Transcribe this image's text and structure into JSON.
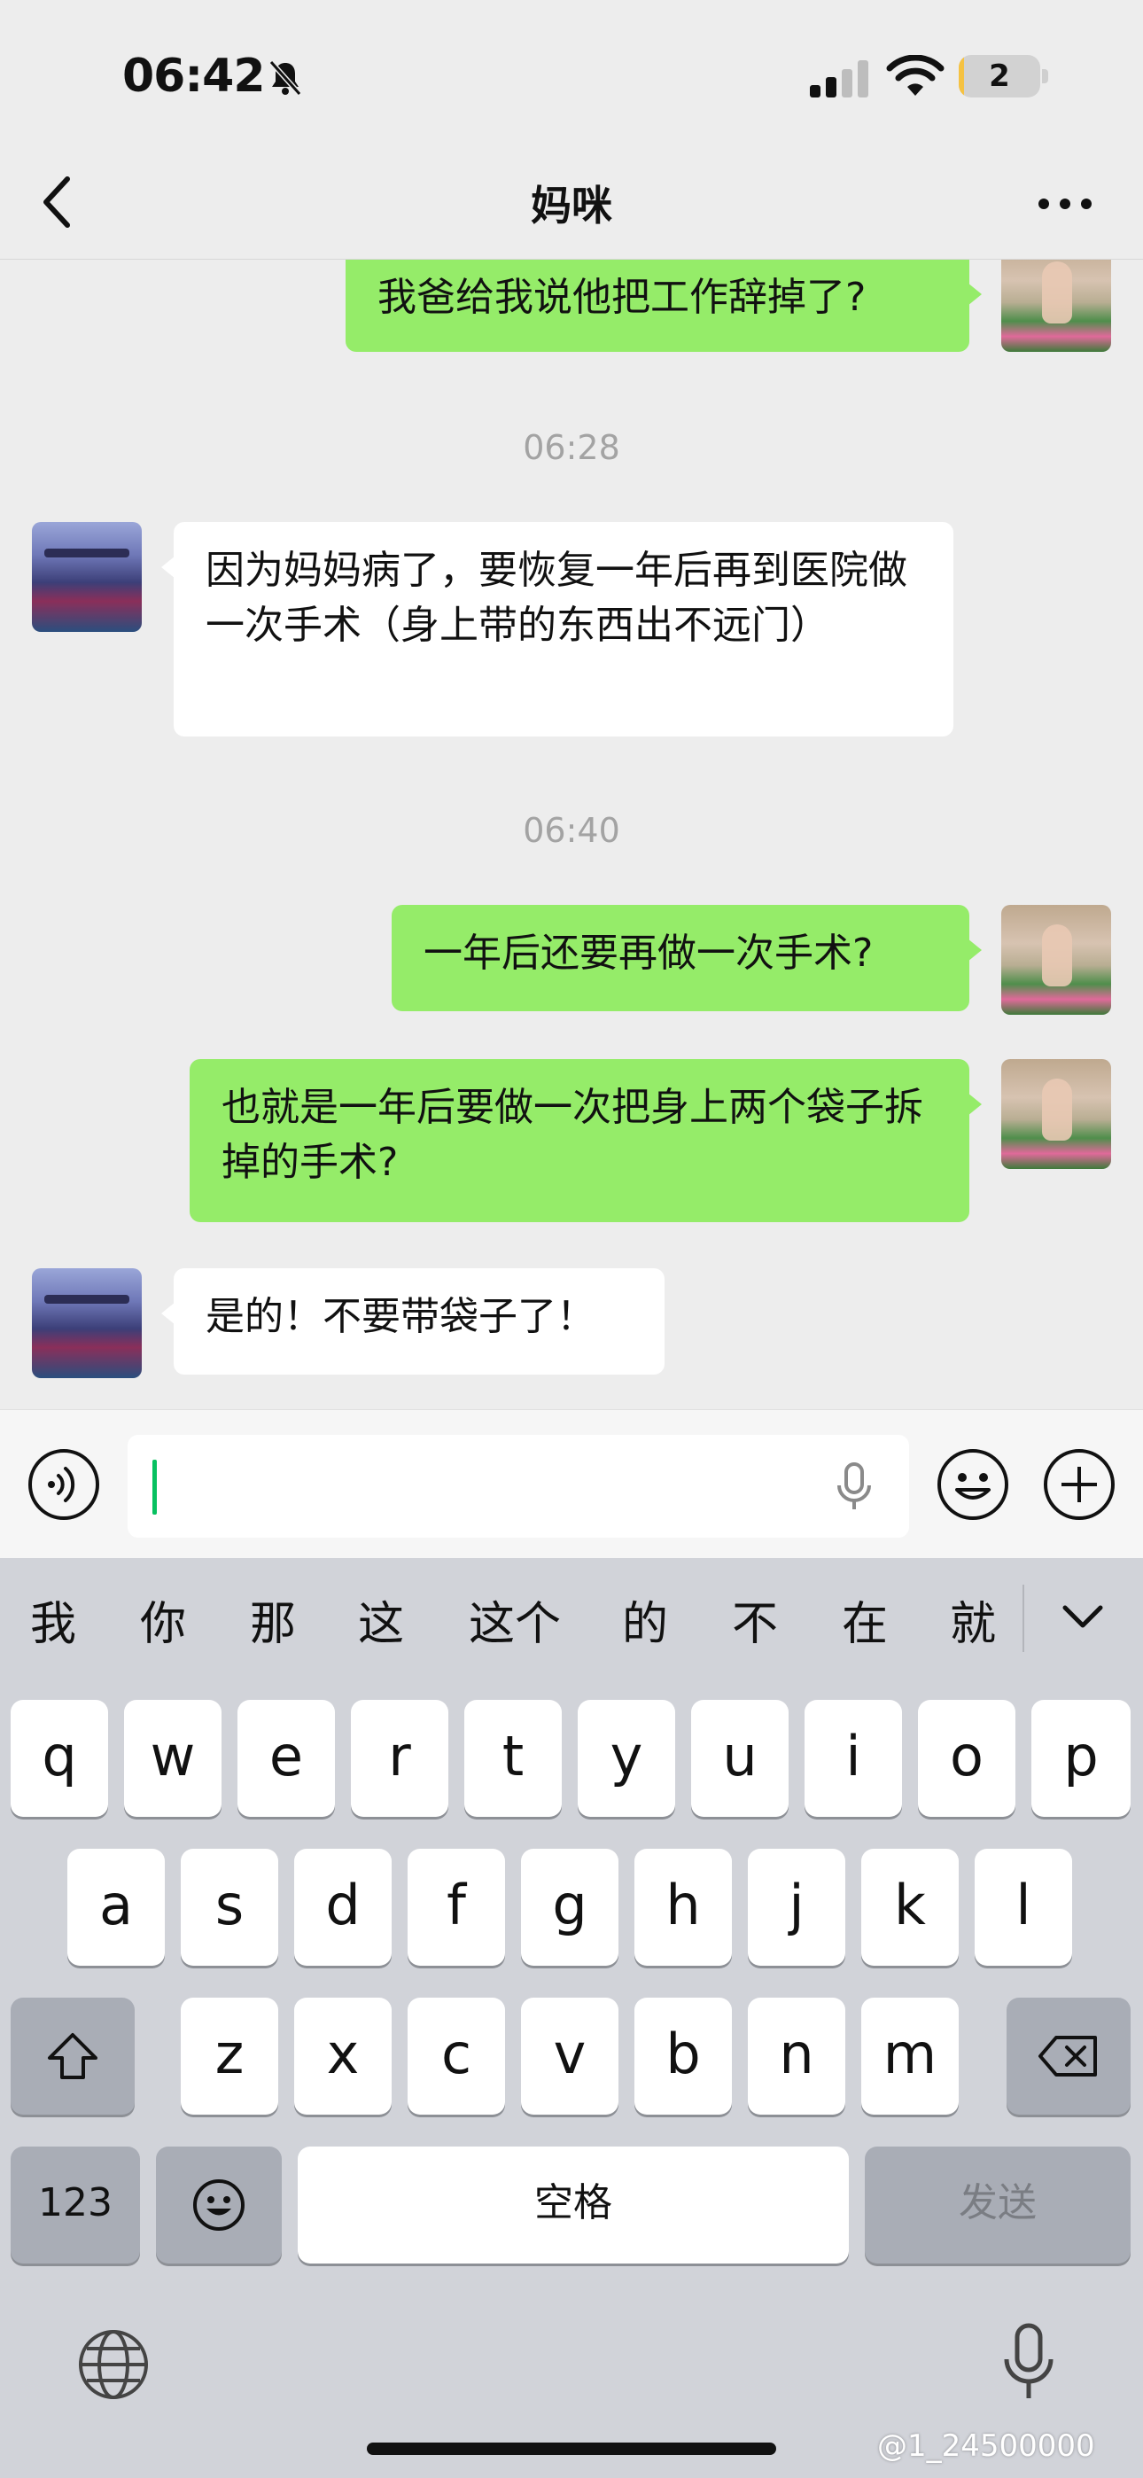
{
  "status_bar": {
    "time": "06:42",
    "battery_level": "2",
    "battery_fraction": 0.02,
    "icons": [
      "bell-off-icon",
      "signal-icon",
      "wifi-icon",
      "battery-icon"
    ]
  },
  "nav": {
    "back_icon": "chevron-left-icon",
    "title": "妈咪",
    "more_icon": "more-icon"
  },
  "chat": {
    "messages": [
      {
        "sender": "self",
        "text": "我爸给我说他把工作辞掉了?"
      },
      {
        "type": "time",
        "text": "06:28"
      },
      {
        "sender": "mom",
        "text": "因为妈妈病了，要恢复一年后再到医院做一次手术（身上带的东西出不远门）"
      },
      {
        "type": "time",
        "text": "06:40"
      },
      {
        "sender": "self",
        "text": "一年后还要再做一次手术?"
      },
      {
        "sender": "self",
        "text": "也就是一年后要做一次把身上两个袋子拆掉的手术?"
      },
      {
        "sender": "mom",
        "text": "是的！不要带袋子了！"
      }
    ]
  },
  "input_bar": {
    "value": "",
    "icons": [
      "voice-icon",
      "mic-icon",
      "emoji-icon",
      "plus-icon"
    ]
  },
  "keyboard": {
    "candidates": [
      "我",
      "你",
      "那",
      "这",
      "这个",
      "的",
      "不",
      "在",
      "就"
    ],
    "row1": [
      "q",
      "w",
      "e",
      "r",
      "t",
      "y",
      "u",
      "i",
      "o",
      "p"
    ],
    "row2": [
      "a",
      "s",
      "d",
      "f",
      "g",
      "h",
      "j",
      "k",
      "l"
    ],
    "row3": [
      "z",
      "x",
      "c",
      "v",
      "b",
      "n",
      "m"
    ],
    "numbers_key": "123",
    "space_label": "空格",
    "send_label": "发送"
  },
  "watermark": "@1_24500000"
}
